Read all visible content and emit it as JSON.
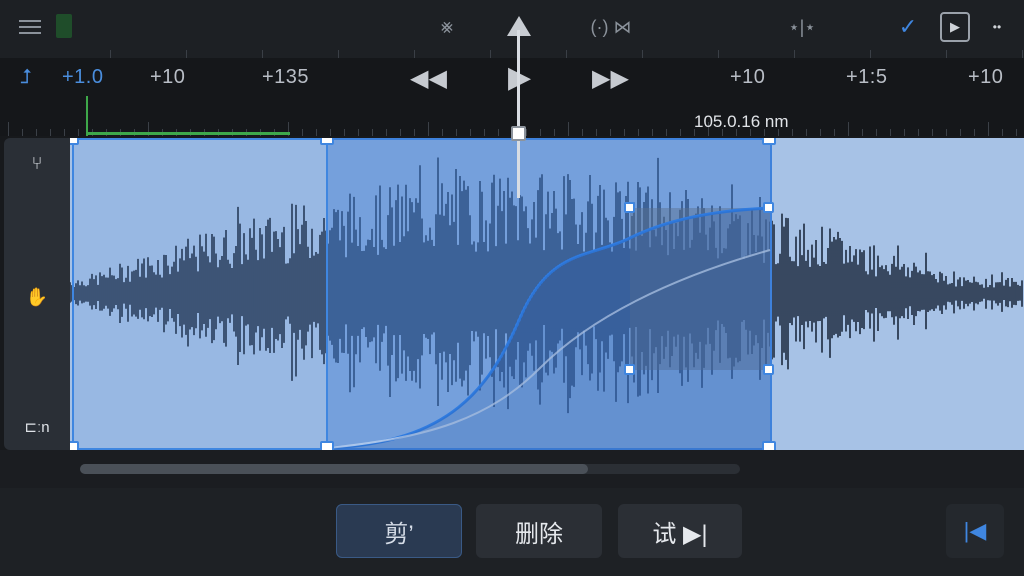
{
  "toolbar": {
    "icons": [
      "menu-icon",
      "collapse-icon",
      "playhead-marker-icon",
      "loop-icon",
      "split-icon",
      "check-icon",
      "play-square-icon",
      "more-icon"
    ],
    "collapse_glyph": "⨳",
    "loop_glyph": "(·) ⋈",
    "split_glyph": "⋆|⋆",
    "check_glyph": "✓",
    "play_square_glyph": "▶",
    "more_glyph": "••"
  },
  "timeline": {
    "labels": [
      "+1.0",
      "+10",
      "+135",
      "+10",
      "+1:5",
      "+10"
    ],
    "time_readout": "105.0.16 nm",
    "rewind_glyph": "◀◀",
    "play_glyph": "▶",
    "forward_glyph": "▶▶",
    "snap_glyph": "⮥"
  },
  "side_panel": {
    "tools": [
      "branch-tool-icon",
      "hand-tool-icon",
      "clip-tool-icon"
    ],
    "branch_glyph": "⑂",
    "hand_glyph": "✋",
    "clip_glyph": "⊏ːn"
  },
  "bottom_bar": {
    "cut_label": "剪’",
    "delete_label": "删除",
    "preview_label": "试 ▶|",
    "to_start_glyph": "|◀"
  },
  "colors": {
    "accent": "#3f86e0",
    "track_bg": "#a7c2e6",
    "waveform": "#1c2a3f",
    "green_marker": "#3ea84a"
  }
}
